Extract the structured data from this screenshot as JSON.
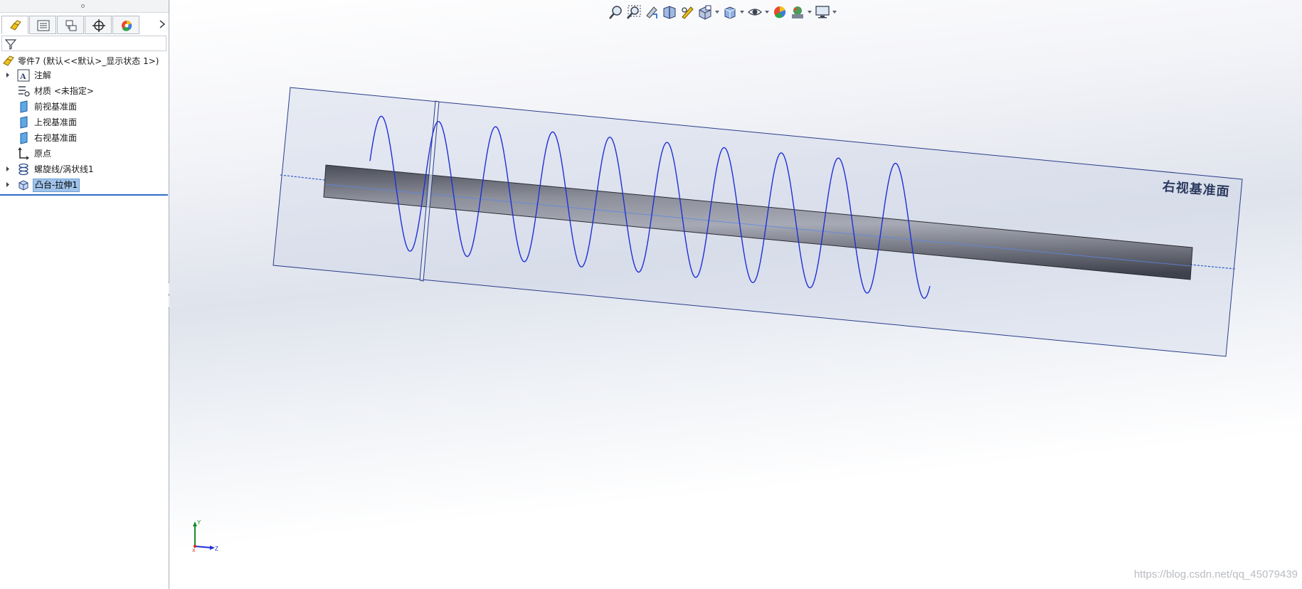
{
  "feature_tree": {
    "part_name": "零件7 (默认<<默认>_显示状态 1>)",
    "items": [
      {
        "label": "注解",
        "icon": "annotations-icon",
        "expandable": true
      },
      {
        "label": "材质 <未指定>",
        "icon": "material-icon",
        "expandable": false
      },
      {
        "label": "前视基准面",
        "icon": "plane-icon",
        "expandable": false
      },
      {
        "label": "上视基准面",
        "icon": "plane-icon",
        "expandable": false
      },
      {
        "label": "右视基准面",
        "icon": "plane-icon",
        "expandable": false
      },
      {
        "label": "原点",
        "icon": "origin-icon",
        "expandable": false
      },
      {
        "label": "螺旋线/涡状线1",
        "icon": "helix-icon",
        "expandable": true
      },
      {
        "label": "凸台-拉伸1",
        "icon": "boss-extrude-icon",
        "expandable": true,
        "selected": true
      }
    ]
  },
  "panel_tabs": [
    {
      "name": "feature-manager-tab",
      "icon": "feature-manager-icon",
      "active": true
    },
    {
      "name": "property-manager-tab",
      "icon": "property-manager-icon",
      "active": false
    },
    {
      "name": "configuration-manager-tab",
      "icon": "configuration-manager-icon",
      "active": false
    },
    {
      "name": "dimxpert-manager-tab",
      "icon": "dimxpert-icon",
      "active": false
    },
    {
      "name": "display-manager-tab",
      "icon": "display-manager-icon",
      "active": false
    }
  ],
  "heads_up_toolbar": [
    "zoom-to-fit-icon",
    "zoom-to-area-icon",
    "previous-view-icon",
    "section-view-icon",
    "dynamic-annotation-icon",
    "view-orientation-icon",
    "display-style-icon",
    "hide-show-items-icon",
    "edit-appearance-icon",
    "apply-scene-icon",
    "view-settings-icon"
  ],
  "viewport": {
    "plane_label": "右视基准面",
    "triad_axes": {
      "y": "Y",
      "z": "Z",
      "x": "X"
    },
    "watermark": "https://blog.csdn.net/qq_45079439"
  },
  "colors": {
    "helix": "#1f2fd6",
    "plane_edge": "#2a3d8a",
    "selection": "#9fc3ea",
    "accent": "#2f6dc6"
  }
}
